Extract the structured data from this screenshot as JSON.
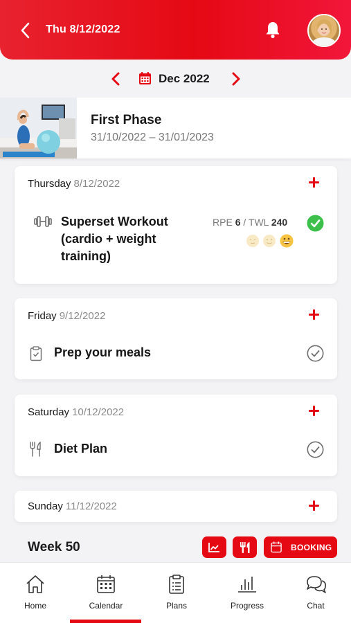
{
  "header": {
    "date": "Thu 8/12/2022",
    "colors": {
      "accent": "#e50914",
      "done": "#3cc04b"
    }
  },
  "month_nav": {
    "label": "Dec 2022"
  },
  "phase": {
    "title": "First Phase",
    "dates": "31/10/2022 – 31/01/2023"
  },
  "days": [
    {
      "day": "Thursday",
      "date": "8/12/2022",
      "item": {
        "title_lines": [
          "Superset Workout",
          "(cardio + weight",
          "training)"
        ],
        "rpe_label": "RPE",
        "rpe_value": "6",
        "sep": "/",
        "twl_label": "TWL",
        "twl_value": "240",
        "status": "completed"
      }
    },
    {
      "day": "Friday",
      "date": "9/12/2022",
      "item": {
        "title": "Prep your meals",
        "icon": "clipboard-icon",
        "status": "pending"
      }
    },
    {
      "day": "Saturday",
      "date": "10/12/2022",
      "item": {
        "title": "Diet Plan",
        "icon": "fork-knife-icon",
        "status": "pending"
      }
    },
    {
      "day": "Sunday",
      "date": "11/12/2022"
    }
  ],
  "week": {
    "title": "Week 50",
    "booking_label": "BOOKING"
  },
  "tabs": [
    {
      "label": "Home",
      "icon": "home-icon"
    },
    {
      "label": "Calendar",
      "icon": "calendar-icon",
      "active": true
    },
    {
      "label": "Plans",
      "icon": "clipboard-icon"
    },
    {
      "label": "Progress",
      "icon": "bar-chart-icon"
    },
    {
      "label": "Chat",
      "icon": "chat-icon"
    }
  ]
}
